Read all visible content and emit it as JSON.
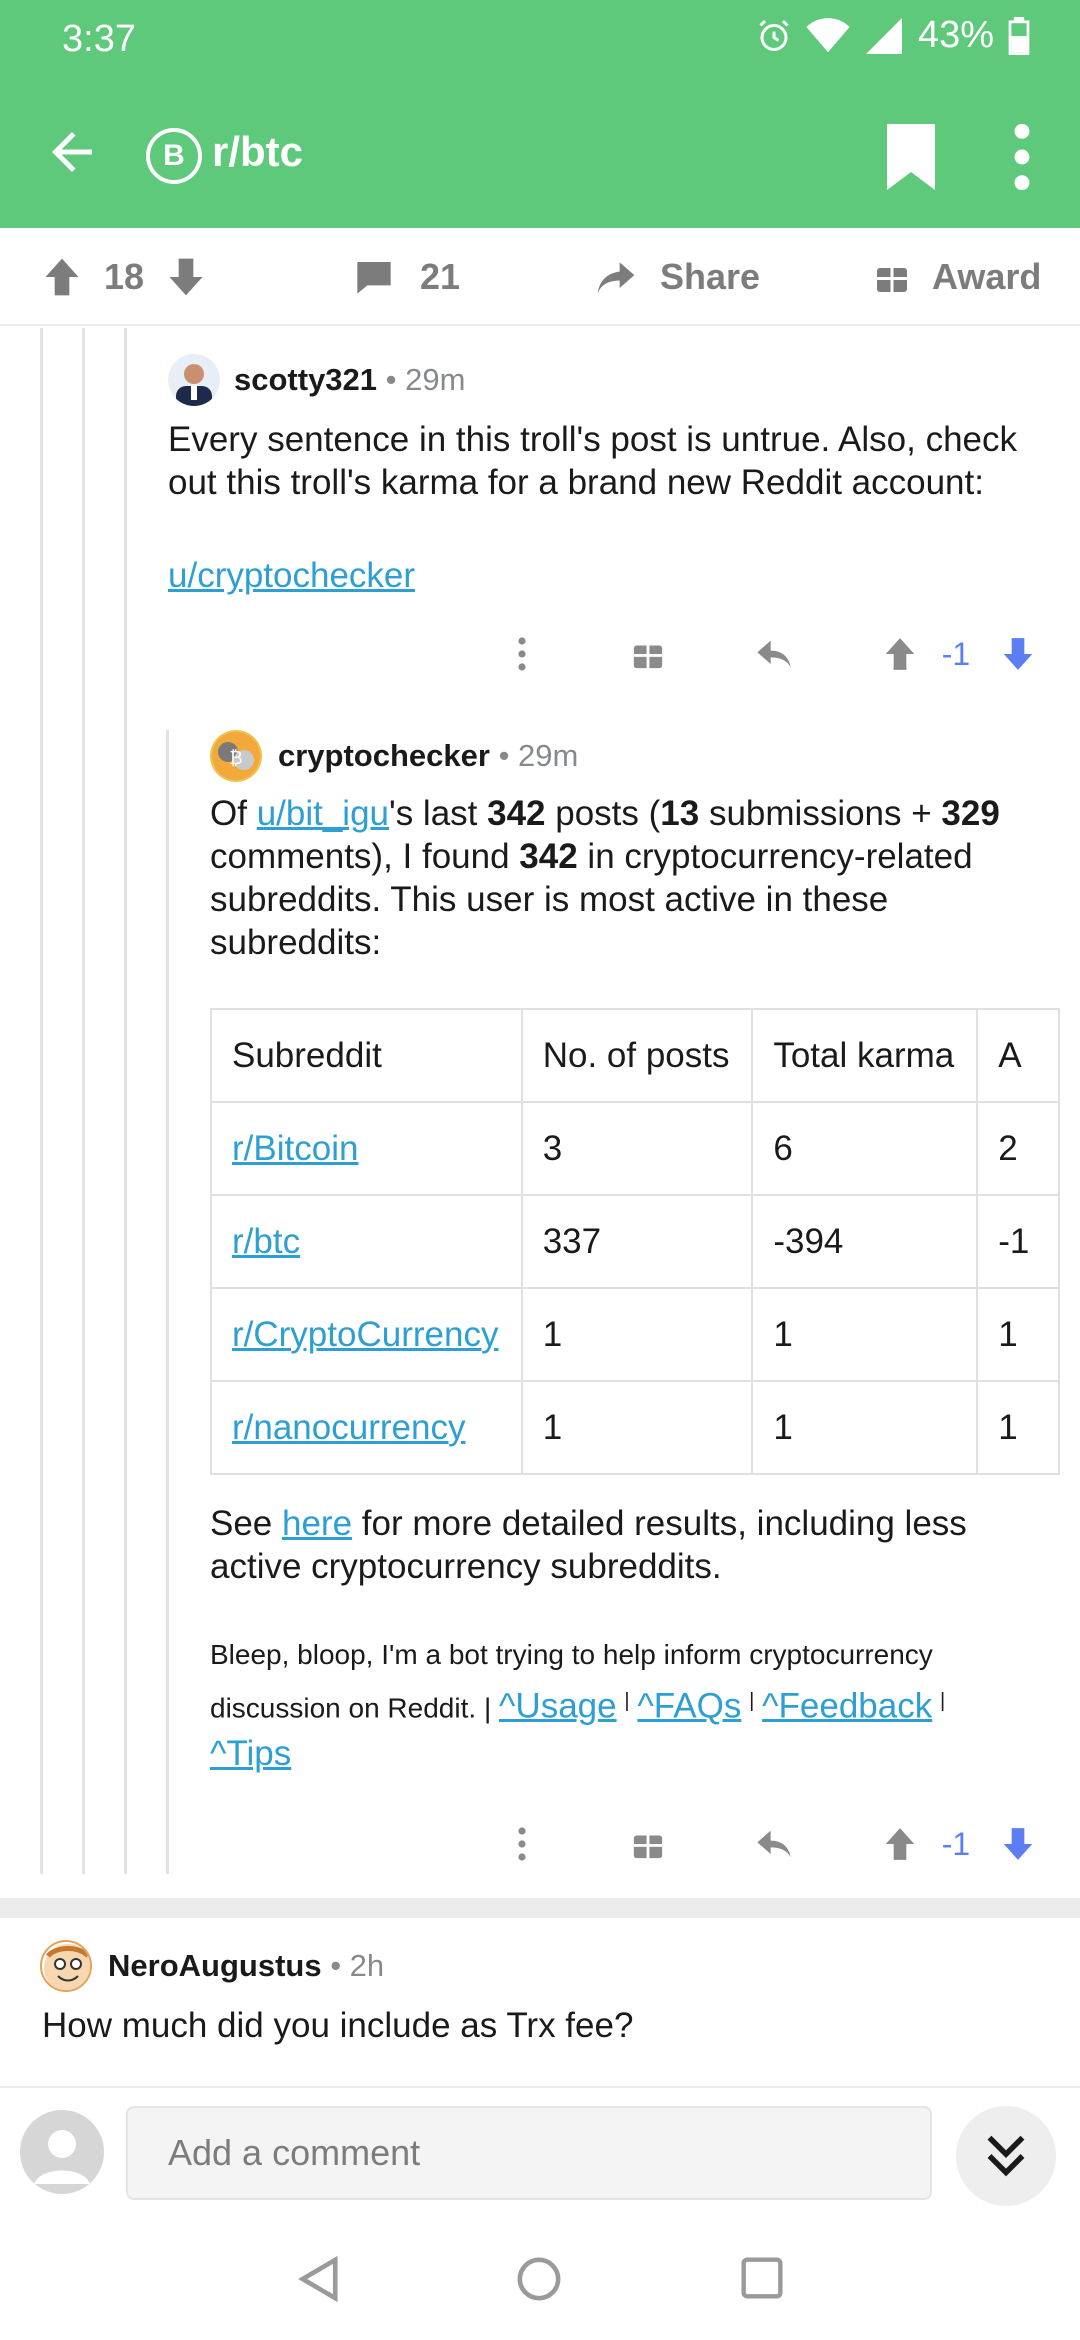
{
  "status_bar": {
    "time": "3:37",
    "battery": "43%"
  },
  "app_bar": {
    "subreddit": "r/btc",
    "icon_letter": "B"
  },
  "post_actions": {
    "score": "18",
    "comments": "21",
    "share_label": "Share",
    "award_label": "Award"
  },
  "comment_scotty": {
    "author": "scotty321",
    "time": "• 29m",
    "text_line1": "Every sentence in this troll's post is untrue. Also, check",
    "text_line2": "out this troll's karma for a brand new Reddit account:",
    "link": "u/cryptochecker",
    "score": "-1"
  },
  "comment_bot": {
    "author": "cryptochecker",
    "time": "• 29m",
    "p1": {
      "of": "Of ",
      "user_link": "u/bit_igu",
      "s1": "'s last ",
      "n1": "342",
      "s2": " posts (",
      "n2": "13",
      "s3": " submissions + ",
      "n3": "329",
      "s4": "comments), I found ",
      "n4": "342",
      "s5": " in cryptocurrency-related",
      "s6": "subreddits. This user is most active in these",
      "s7": "subreddits:"
    },
    "table": {
      "headers": [
        "Subreddit",
        "No. of posts",
        "Total karma",
        "A"
      ],
      "rows": [
        [
          "r/Bitcoin",
          "3",
          "6",
          "2"
        ],
        [
          "r/btc",
          "337",
          "-394",
          "-1"
        ],
        [
          "r/CryptoCurrency",
          "1",
          "1",
          "1"
        ],
        [
          "r/nanocurrency",
          "1",
          "1",
          "1"
        ]
      ]
    },
    "see": {
      "pre": "See ",
      "link": "here",
      "post": " for more detailed results, including less",
      "line2": "active cryptocurrency subreddits."
    },
    "footer": {
      "line1": "Bleep, bloop, I'm a bot trying to help inform cryptocurrency",
      "line2": "discussion on Reddit.",
      "sep": "|",
      "usage": "^Usage",
      "faqs": "^FAQs",
      "feedback": "^Feedback",
      "tips": "^Tips"
    },
    "score": "-1"
  },
  "comment_nero": {
    "author": "NeroAugustus",
    "time": "• 2h",
    "text": "How much did you include as Trx fee?"
  },
  "composer": {
    "placeholder": "Add a comment"
  }
}
